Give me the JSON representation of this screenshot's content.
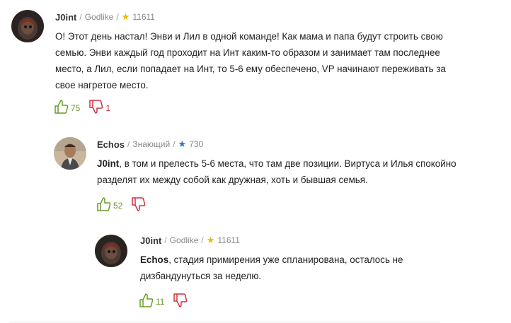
{
  "comments": [
    {
      "author": "J0int",
      "rank": "Godlike",
      "rating": "11611",
      "star_color": "#f5b800",
      "mention": "",
      "text": "О! Этот день настал! Энви и Лил в одной команде! Как мама и папа будут строить свою семью. Энви каждый год проходит на Инт каким-то образом и занимает там последнее место, а Лил, если попадает на Инт, то 5-6 ему обеспечено, VP начинают переживать за свое нагретое место.",
      "likes": "75",
      "dislikes": "1"
    },
    {
      "author": "Echos",
      "rank": "Знающий",
      "rating": "730",
      "star_color": "#2a6fd8",
      "mention": "J0int",
      "text": ", в том и прелесть 5-6 места, что там две позиции. Виртуса и Илья спокойно разделят их между собой как дружная, хоть и бывшая семья.",
      "likes": "52",
      "dislikes": ""
    },
    {
      "author": "J0int",
      "rank": "Godlike",
      "rating": "11611",
      "star_color": "#f5b800",
      "mention": "Echos",
      "text": ", стадия примирения уже спланирована, осталось не дизбандунуться за неделю.",
      "likes": "11",
      "dislikes": ""
    }
  ],
  "colors": {
    "like": "#6a9a2a",
    "dislike": "#d0303d"
  },
  "icons": {
    "like": "thumbs-up-icon",
    "dislike": "thumbs-down-icon",
    "star": "star-icon"
  }
}
